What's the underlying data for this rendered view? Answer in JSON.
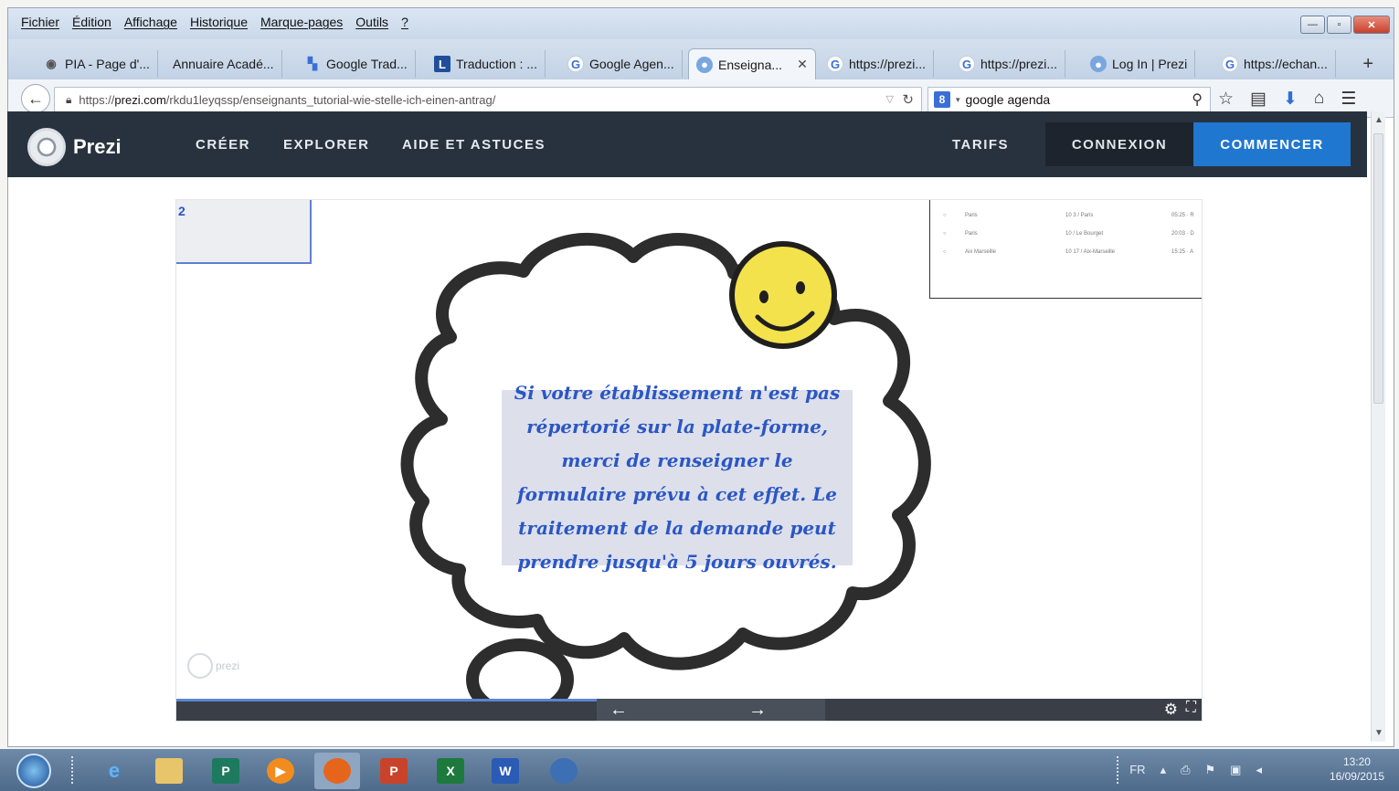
{
  "browser": {
    "menu": [
      "Fichier",
      "Édition",
      "Affichage",
      "Historique",
      "Marque-pages",
      "Outils",
      "?"
    ],
    "tabs": [
      {
        "label": "PIA - Page d'...",
        "icon": "globe-icon"
      },
      {
        "label": "Annuaire Acadé...",
        "icon": "none"
      },
      {
        "label": "Google Trad...",
        "icon": "translate-icon"
      },
      {
        "label": "Traduction : ...",
        "icon": "l-icon"
      },
      {
        "label": "Google Agen...",
        "icon": "google-icon"
      },
      {
        "label": "Enseigna...",
        "icon": "prezi-icon",
        "active": true
      },
      {
        "label": "https://prezi...",
        "icon": "google-icon"
      },
      {
        "label": "https://prezi...",
        "icon": "google-icon"
      },
      {
        "label": "Log In | Prezi",
        "icon": "prezi-icon"
      },
      {
        "label": "https://echan...",
        "icon": "google-icon"
      }
    ],
    "url_prefix": "https://",
    "url_domain": "prezi.com",
    "url_path": "/rkdu1leyqssp/enseignants_tutorial-wie-stelle-ich-einen-antrag/",
    "search_value": "google agenda"
  },
  "prezi": {
    "logo_text": "Prezi",
    "nav": [
      "CRÉER",
      "EXPLORER",
      "AIDE ET ASTUCES"
    ],
    "tarifs": "TARIFS",
    "connexion": "CONNEXION",
    "commencer": "COMMENCER"
  },
  "slide": {
    "cloud_text": "Si votre établissement n'est pas répertorié sur la plate-forme, merci de renseigner le formulaire prévu à cet effet. Le traitement de la demande peut prendre jusqu'à 5 jours ouvrés.",
    "watermark": "prezi",
    "left_card_mark": "2",
    "table_rows": [
      [
        "Paris",
        "10 3 / Paris",
        "05:25 · R"
      ],
      [
        "Paris",
        "10 / Le Bourget",
        "20:03 · D"
      ],
      [
        "Aix Marseille",
        "10 17 / Aix-Marseille",
        "15:25 · A"
      ]
    ]
  },
  "taskbar": {
    "apps": [
      "Internet Explorer",
      "Explorer",
      "Publisher",
      "Media Player",
      "Firefox",
      "PowerPoint",
      "Excel",
      "Word",
      "Thunderbird"
    ],
    "lang": "FR",
    "time": "13:20",
    "date": "16/09/2015"
  },
  "colors": {
    "prezi_bar": "#28323f",
    "commencer_blue": "#2077cf",
    "cloud_text": "#2b56c4",
    "smiley": "#f3e24c"
  }
}
